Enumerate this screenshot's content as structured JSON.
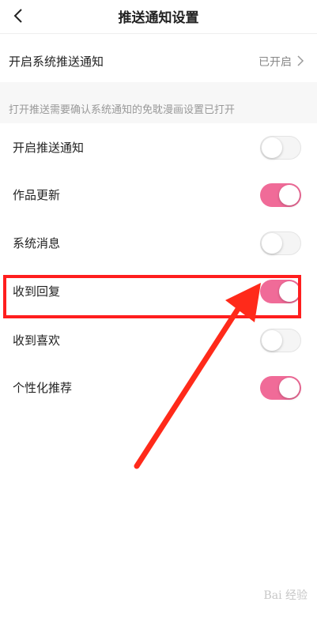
{
  "header": {
    "title": "推送通知设置"
  },
  "system_push": {
    "label": "开启系统推送通知",
    "value": "已开启"
  },
  "tip": "打开推送需要确认系统通知的免耽漫画设置已打开",
  "rows": [
    {
      "label": "开启推送通知",
      "on": false
    },
    {
      "label": "作品更新",
      "on": true
    },
    {
      "label": "系统消息",
      "on": false
    },
    {
      "label": "收到回复",
      "on": true
    },
    {
      "label": "收到喜欢",
      "on": false
    },
    {
      "label": "个性化推荐",
      "on": true
    }
  ],
  "watermark": "Bai 经验",
  "colors": {
    "toggle_on": "#f06b98",
    "annotation": "#ff1e1e"
  }
}
